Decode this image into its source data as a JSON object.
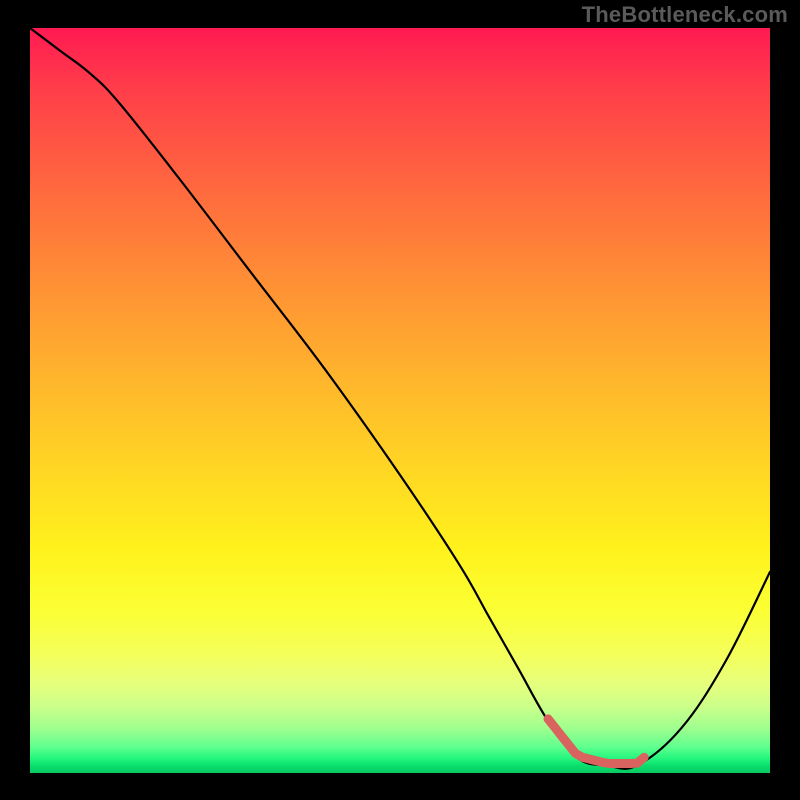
{
  "watermark": "TheBottleneck.com",
  "chart_data": {
    "type": "line",
    "title": "",
    "xlabel": "",
    "ylabel": "",
    "xlim": [
      0,
      100
    ],
    "ylim": [
      0,
      100
    ],
    "grid": false,
    "series": [
      {
        "name": "bottleneck-curve",
        "x": [
          0,
          4,
          8,
          12,
          20,
          30,
          40,
          50,
          58,
          62,
          66,
          70,
          74,
          78,
          82,
          88,
          94,
          100
        ],
        "values": [
          100,
          97,
          94,
          90,
          80,
          67,
          54,
          40,
          28,
          21,
          14,
          7,
          2,
          1,
          1,
          6,
          15,
          27
        ],
        "color": "#000000"
      }
    ],
    "annotations": [
      {
        "name": "optimal-band",
        "x_start": 70,
        "x_end": 83,
        "color": "#d9635f"
      }
    ],
    "background_gradient_stops": [
      {
        "pos": 0,
        "color": "#ff1a52"
      },
      {
        "pos": 50,
        "color": "#ffd324"
      },
      {
        "pos": 80,
        "color": "#fbff33"
      },
      {
        "pos": 100,
        "color": "#07c85f"
      }
    ]
  }
}
